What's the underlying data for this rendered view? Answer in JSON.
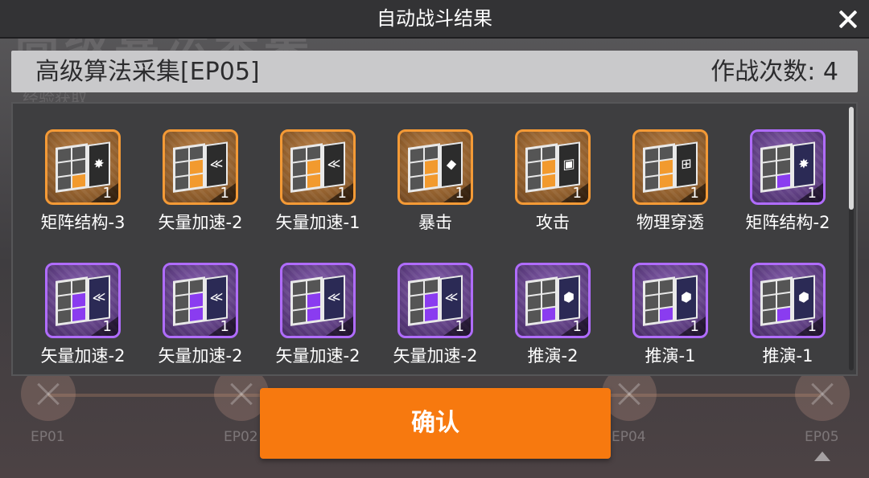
{
  "background": {
    "title": "高级算法采集",
    "subtitle": "经验获取",
    "stages": [
      "EP01",
      "EP02",
      "EP04",
      "EP05"
    ]
  },
  "header": {
    "title": "自动战斗结果",
    "close_icon": "close-icon"
  },
  "stage_bar": {
    "stage_name": "高级算法采集[EP05]",
    "battle_count": "作战次数: 4"
  },
  "colors": {
    "accent": "#f7790f",
    "rarity_orange": "#f49a36",
    "rarity_purple": "#b06cff"
  },
  "items": [
    {
      "name": "矩阵结构-3",
      "qty": "1",
      "rarity": "orange",
      "icon": "matrix-chip-icon"
    },
    {
      "name": "矢量加速-2",
      "qty": "1",
      "rarity": "orange",
      "icon": "vector-chip-icon"
    },
    {
      "name": "矢量加速-1",
      "qty": "1",
      "rarity": "orange",
      "icon": "vector-chip-icon"
    },
    {
      "name": "暴击",
      "qty": "1",
      "rarity": "orange",
      "icon": "crit-chip-icon"
    },
    {
      "name": "攻击",
      "qty": "1",
      "rarity": "orange",
      "icon": "attack-chip-icon"
    },
    {
      "name": "物理穿透",
      "qty": "1",
      "rarity": "orange",
      "icon": "pierce-chip-icon"
    },
    {
      "name": "矩阵结构-2",
      "qty": "1",
      "rarity": "purple",
      "icon": "matrix-chip-icon"
    },
    {
      "name": "矢量加速-2",
      "qty": "1",
      "rarity": "purple",
      "icon": "vector-chip-icon"
    },
    {
      "name": "矢量加速-2",
      "qty": "1",
      "rarity": "purple",
      "icon": "vector-chip-icon"
    },
    {
      "name": "矢量加速-2",
      "qty": "1",
      "rarity": "purple",
      "icon": "vector-chip-icon"
    },
    {
      "name": "矢量加速-2",
      "qty": "1",
      "rarity": "purple",
      "icon": "vector-chip-icon"
    },
    {
      "name": "推演-2",
      "qty": "1",
      "rarity": "purple",
      "icon": "deduction-chip-icon"
    },
    {
      "name": "推演-1",
      "qty": "1",
      "rarity": "purple",
      "icon": "deduction-chip-icon"
    },
    {
      "name": "推演-1",
      "qty": "1",
      "rarity": "purple",
      "icon": "deduction-chip-icon"
    }
  ],
  "confirm": {
    "label": "确认"
  }
}
